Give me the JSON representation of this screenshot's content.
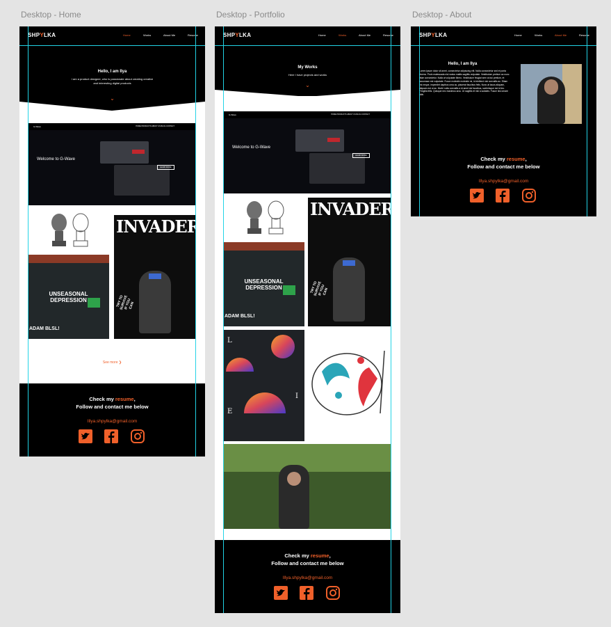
{
  "frames": {
    "home_label": "Desktop - Home",
    "portfolio_label": "Desktop - Portfolio",
    "about_label": "Desktop - About"
  },
  "brand": {
    "logo_pre": "SHP",
    "logo_y": "Y",
    "logo_post": "LKA"
  },
  "nav": {
    "home": "Home",
    "works": "Works",
    "about": "About Me",
    "resume": "Resume"
  },
  "home_hero": {
    "title": "Hello, I am Ilya",
    "subtitle_1": "I am a product designer, who is passionate about creating creative",
    "subtitle_2": "and interesting digital products"
  },
  "portfolio_hero": {
    "title": "My Works",
    "subtitle": "Here I have projects and works"
  },
  "gwave": {
    "logo": "G-Wave",
    "nav": "HOME   PRODUCTS   ABOUT US   BLOG   CONTACT",
    "title": "Welcome to G-Wave",
    "button": "LEARN MORE"
  },
  "posters": {
    "invader": "INVADER",
    "depression_1": "UNSEASONAL",
    "depression_2": "DEPRESSION",
    "adam": "ADAM BLSL!",
    "invader_side": "TRY TO SURVIVE IF YOU CAN",
    "lie_l": "L",
    "lie_i": "I",
    "lie_e": "E"
  },
  "see_more": "See more ❯",
  "footer": {
    "check": "Check my ",
    "resume": "resume",
    "comma": ",",
    "follow": "Follow and contact me below",
    "email": "Illya.shpylka@gmail.com"
  },
  "about": {
    "title": "Hello, I am Ilya",
    "body": "Lorem ipsum dolor sit amet, consectetur adipiscing elit. Nulla consectetur sed et porta viverra. Proin malesuada nisl varius mattis sagittis vulputate. Vestibulum pretium ac nunc vitae consectetur. Nulla at vulputate libero. Vestibulum feugiat sem at dui pretium, et accumsan est vulputate. Fusce molestie molestie mi, id eleifend nisi convallis ac. Etiam est neque, imperdiet dapibus urna ac, placerat faucibus felis. Nunc at lacus aliquam, aliquam est ut ac. Morbi nulla convallis a id amet dui faucibus, scelerisque est id leo. Fringilla felis. Quisque nec maximus arcu. Ut sagittis et nisi a sodales. Fusce nisi omare nibh."
  },
  "colors": {
    "accent": "#f0602a",
    "guide": "#22d3e6",
    "board": "#000000",
    "canvas": "#e4e4e4"
  },
  "icons": [
    "twitter-icon",
    "facebook-icon",
    "instagram-icon",
    "chevron-down-icon"
  ]
}
